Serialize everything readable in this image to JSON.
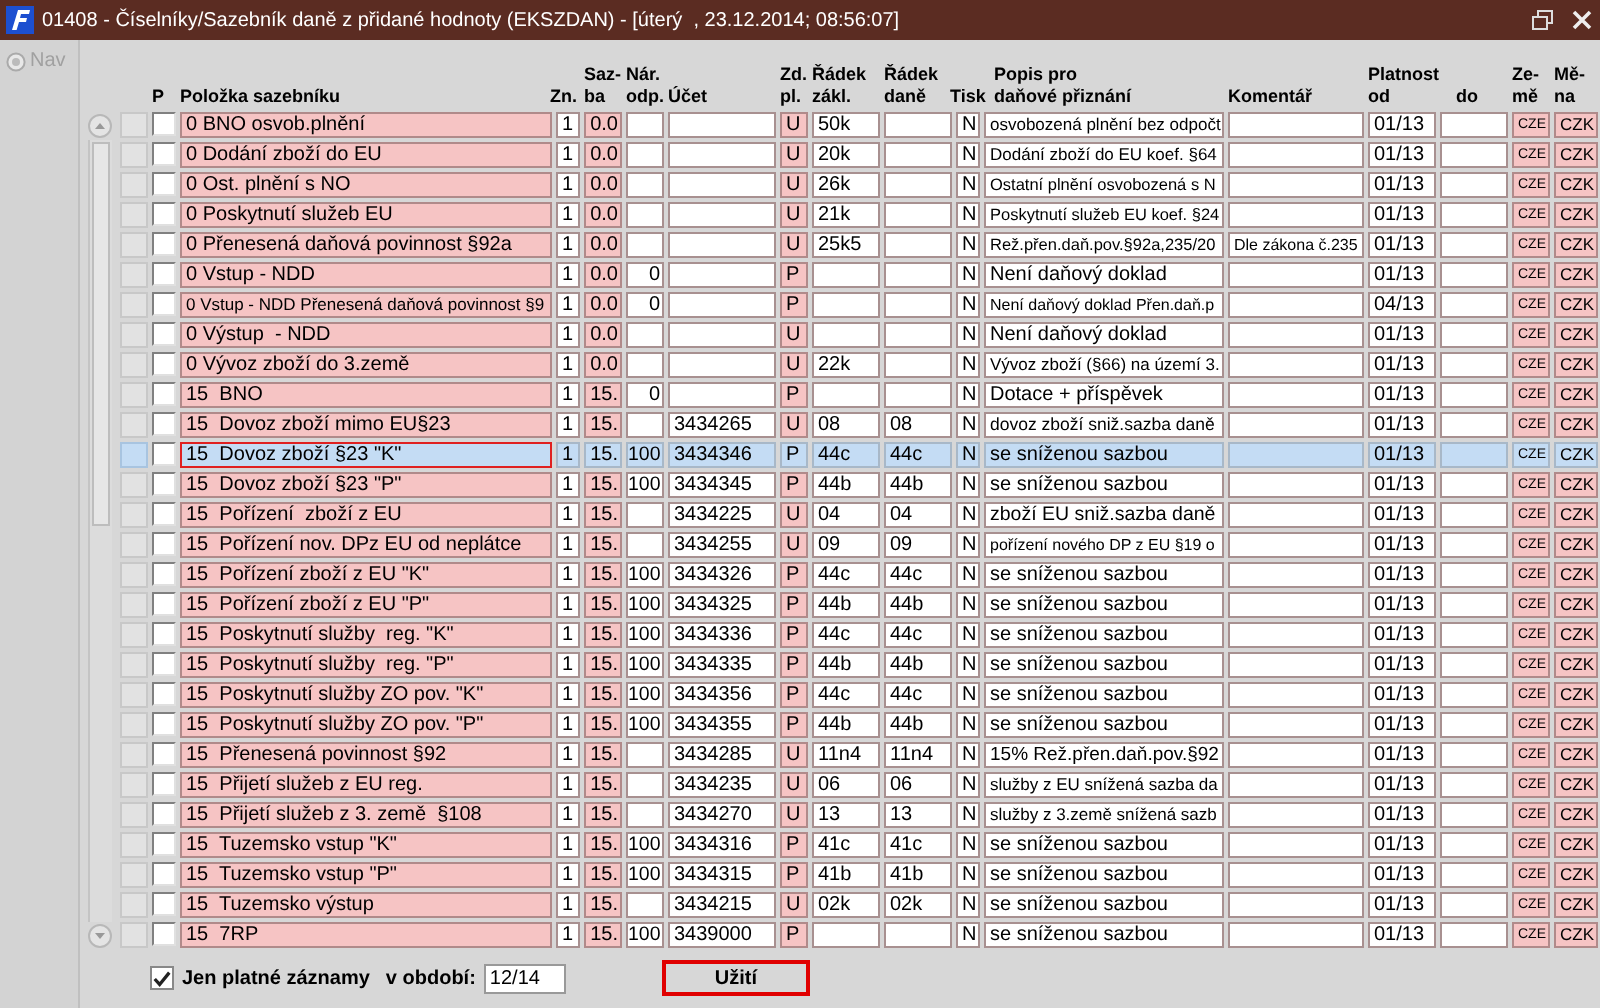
{
  "window": {
    "title": "01408 - Číselníky/Sazebník daně z přidané hodnoty (EKSZDAN) - [úterý  , 23.12.2014; 08:56:07]"
  },
  "nav": {
    "label": "Nav",
    "disabled": true
  },
  "table": {
    "columns": [
      {
        "label": "P"
      },
      {
        "label": "Položka sazebníku"
      },
      {
        "label": "Zn."
      },
      {
        "label": "Saz-\nba"
      },
      {
        "label": "Nár.\nodp."
      },
      {
        "label": "Účet"
      },
      {
        "label": "Zd.\npl."
      },
      {
        "label": "Řádek\nzákl."
      },
      {
        "label": "Řádek\ndaně"
      },
      {
        "label": "Tisk"
      },
      {
        "label": "Popis pro\ndaňové přiznání"
      },
      {
        "label": "Komentář"
      },
      {
        "label": "Platnost\nod"
      },
      {
        "label": "do"
      },
      {
        "label": "Ze-\nmě"
      },
      {
        "label": "Mě-\nna"
      }
    ],
    "rows": [
      {
        "selected": false,
        "checked": false,
        "item": "0 BNO osvob.plnění",
        "zn": "1",
        "sazba": "0.0",
        "zd_pl": "U",
        "radek_zakl": "50k",
        "tisk": "N",
        "popis": "osvobozená plnění bez odpočt",
        "platnost_od": "01/13",
        "zeme": "CZE",
        "mena": "CZK"
      },
      {
        "selected": false,
        "checked": false,
        "item": "0 Dodání zboží do EU",
        "zn": "1",
        "sazba": "0.0",
        "zd_pl": "U",
        "radek_zakl": "20k",
        "tisk": "N",
        "popis": "Dodání zboží do EU koef. §64",
        "platnost_od": "01/13",
        "zeme": "CZE",
        "mena": "CZK"
      },
      {
        "selected": false,
        "checked": false,
        "item": "0 Ost. plnění s NO",
        "zn": "1",
        "sazba": "0.0",
        "zd_pl": "U",
        "radek_zakl": "26k",
        "tisk": "N",
        "popis": "Ostatní plnění osvobozená s N",
        "platnost_od": "01/13",
        "zeme": "CZE",
        "mena": "CZK"
      },
      {
        "selected": false,
        "checked": false,
        "item": "0 Poskytnutí služeb EU",
        "zn": "1",
        "sazba": "0.0",
        "zd_pl": "U",
        "radek_zakl": "21k",
        "tisk": "N",
        "popis": "Poskytnutí služeb EU koef. §24",
        "platnost_od": "01/13",
        "zeme": "CZE",
        "mena": "CZK"
      },
      {
        "selected": false,
        "checked": false,
        "item": "0 Přenesená daňová povinnost §92a",
        "zn": "1",
        "sazba": "0.0",
        "zd_pl": "U",
        "radek_zakl": "25k5",
        "tisk": "N",
        "popis": "Rež.přen.daň.pov.§92a,235/20",
        "komentar": "Dle zákona č.235",
        "platnost_od": "01/13",
        "zeme": "CZE",
        "mena": "CZK"
      },
      {
        "selected": false,
        "checked": false,
        "item": "0 Vstup - NDD",
        "zn": "1",
        "sazba": "0.0",
        "nar_odp": "0",
        "zd_pl": "P",
        "tisk": "N",
        "popis": "Není daňový doklad",
        "platnost_od": "01/13",
        "zeme": "CZE",
        "mena": "CZK"
      },
      {
        "selected": false,
        "checked": false,
        "item": "0 Vstup - NDD Přenesená daňová povinnost §9",
        "zn": "1",
        "sazba": "0.0",
        "nar_odp": "0",
        "zd_pl": "P",
        "tisk": "N",
        "popis": "Není daňový doklad Přen.daň.p",
        "platnost_od": "04/13",
        "zeme": "CZE",
        "mena": "CZK"
      },
      {
        "selected": false,
        "checked": false,
        "item": "0 Výstup  - NDD",
        "zn": "1",
        "sazba": "0.0",
        "zd_pl": "U",
        "tisk": "N",
        "popis": "Není daňový doklad",
        "platnost_od": "01/13",
        "zeme": "CZE",
        "mena": "CZK"
      },
      {
        "selected": false,
        "checked": false,
        "item": "0 Vývoz zboží do 3.země",
        "zn": "1",
        "sazba": "0.0",
        "zd_pl": "U",
        "radek_zakl": "22k",
        "tisk": "N",
        "popis": "Vývoz zboží (§66) na území 3.",
        "platnost_od": "01/13",
        "zeme": "CZE",
        "mena": "CZK"
      },
      {
        "selected": false,
        "checked": false,
        "item": "15  BNO",
        "zn": "1",
        "sazba": "15.",
        "nar_odp": "0",
        "zd_pl": "P",
        "tisk": "N",
        "popis": "Dotace + příspěvek",
        "platnost_od": "01/13",
        "zeme": "CZE",
        "mena": "CZK"
      },
      {
        "selected": false,
        "checked": false,
        "item": "15  Dovoz zboží mimo EU§23",
        "zn": "1",
        "sazba": "15.",
        "ucet": "3434265",
        "zd_pl": "U",
        "radek_zakl": "08",
        "radek_dane": "08",
        "tisk": "N",
        "popis": "dovoz zboží sniž.sazba daně",
        "platnost_od": "01/13",
        "zeme": "CZE",
        "mena": "CZK"
      },
      {
        "selected": true,
        "checked": false,
        "item": "15  Dovoz zboží §23 \"K\"",
        "zn": "1",
        "sazba": "15.",
        "nar_odp": "100",
        "ucet": "3434346",
        "zd_pl": "P",
        "radek_zakl": "44c",
        "radek_dane": "44c",
        "tisk": "N",
        "popis": "se sníženou sazbou",
        "platnost_od": "01/13",
        "zeme": "CZE",
        "mena": "CZK"
      },
      {
        "selected": false,
        "checked": false,
        "item": "15  Dovoz zboží §23 \"P\"",
        "zn": "1",
        "sazba": "15.",
        "nar_odp": "100",
        "ucet": "3434345",
        "zd_pl": "P",
        "radek_zakl": "44b",
        "radek_dane": "44b",
        "tisk": "N",
        "popis": "se sníženou sazbou",
        "platnost_od": "01/13",
        "zeme": "CZE",
        "mena": "CZK"
      },
      {
        "selected": false,
        "checked": false,
        "item": "15  Pořízení  zboží z EU",
        "zn": "1",
        "sazba": "15.",
        "ucet": "3434225",
        "zd_pl": "U",
        "radek_zakl": "04",
        "radek_dane": "04",
        "tisk": "N",
        "popis": "zboží EU sniž.sazba daně",
        "platnost_od": "01/13",
        "zeme": "CZE",
        "mena": "CZK"
      },
      {
        "selected": false,
        "checked": false,
        "item": "15  Pořízení nov. DPz EU od neplátce",
        "zn": "1",
        "sazba": "15.",
        "ucet": "3434255",
        "zd_pl": "U",
        "radek_zakl": "09",
        "radek_dane": "09",
        "tisk": "N",
        "popis": "pořízení nového DP z EU §19 o",
        "platnost_od": "01/13",
        "zeme": "CZE",
        "mena": "CZK"
      },
      {
        "selected": false,
        "checked": false,
        "item": "15  Pořízení zboží z EU \"K\"",
        "zn": "1",
        "sazba": "15.",
        "nar_odp": "100",
        "ucet": "3434326",
        "zd_pl": "P",
        "radek_zakl": "44c",
        "radek_dane": "44c",
        "tisk": "N",
        "popis": "se sníženou sazbou",
        "platnost_od": "01/13",
        "zeme": "CZE",
        "mena": "CZK"
      },
      {
        "selected": false,
        "checked": false,
        "item": "15  Pořízení zboží z EU \"P\"",
        "zn": "1",
        "sazba": "15.",
        "nar_odp": "100",
        "ucet": "3434325",
        "zd_pl": "P",
        "radek_zakl": "44b",
        "radek_dane": "44b",
        "tisk": "N",
        "popis": "se sníženou sazbou",
        "platnost_od": "01/13",
        "zeme": "CZE",
        "mena": "CZK"
      },
      {
        "selected": false,
        "checked": false,
        "item": "15  Poskytnutí služby  reg. \"K\"",
        "zn": "1",
        "sazba": "15.",
        "nar_odp": "100",
        "ucet": "3434336",
        "zd_pl": "P",
        "radek_zakl": "44c",
        "radek_dane": "44c",
        "tisk": "N",
        "popis": "se sníženou sazbou",
        "platnost_od": "01/13",
        "zeme": "CZE",
        "mena": "CZK"
      },
      {
        "selected": false,
        "checked": false,
        "item": "15  Poskytnutí služby  reg. \"P\"",
        "zn": "1",
        "sazba": "15.",
        "nar_odp": "100",
        "ucet": "3434335",
        "zd_pl": "P",
        "radek_zakl": "44b",
        "radek_dane": "44b",
        "tisk": "N",
        "popis": "se sníženou sazbou",
        "platnost_od": "01/13",
        "zeme": "CZE",
        "mena": "CZK"
      },
      {
        "selected": false,
        "checked": false,
        "item": "15  Poskytnutí služby ZO pov. \"K\"",
        "zn": "1",
        "sazba": "15.",
        "nar_odp": "100",
        "ucet": "3434356",
        "zd_pl": "P",
        "radek_zakl": "44c",
        "radek_dane": "44c",
        "tisk": "N",
        "popis": "se sníženou sazbou",
        "platnost_od": "01/13",
        "zeme": "CZE",
        "mena": "CZK"
      },
      {
        "selected": false,
        "checked": false,
        "item": "15  Poskytnutí služby ZO pov. \"P\"",
        "zn": "1",
        "sazba": "15.",
        "nar_odp": "100",
        "ucet": "3434355",
        "zd_pl": "P",
        "radek_zakl": "44b",
        "radek_dane": "44b",
        "tisk": "N",
        "popis": "se sníženou sazbou",
        "platnost_od": "01/13",
        "zeme": "CZE",
        "mena": "CZK"
      },
      {
        "selected": false,
        "checked": false,
        "item": "15  Přenesená povinnost §92",
        "zn": "1",
        "sazba": "15.",
        "ucet": "3434285",
        "zd_pl": "U",
        "radek_zakl": "11n4",
        "radek_dane": "11n4",
        "tisk": "N",
        "popis": "15% Rež.přen.daň.pov.§92",
        "platnost_od": "01/13",
        "zeme": "CZE",
        "mena": "CZK"
      },
      {
        "selected": false,
        "checked": false,
        "item": "15  Přijetí služeb z EU reg.",
        "zn": "1",
        "sazba": "15.",
        "ucet": "3434235",
        "zd_pl": "U",
        "radek_zakl": "06",
        "radek_dane": "06",
        "tisk": "N",
        "popis": "služby z EU snížená sazba da",
        "platnost_od": "01/13",
        "zeme": "CZE",
        "mena": "CZK"
      },
      {
        "selected": false,
        "checked": false,
        "item": "15  Přijetí služeb z 3. země  §108",
        "zn": "1",
        "sazba": "15.",
        "ucet": "3434270",
        "zd_pl": "U",
        "radek_zakl": "13",
        "radek_dane": "13",
        "tisk": "N",
        "popis": "služby z 3.země snížená sazb",
        "platnost_od": "01/13",
        "zeme": "CZE",
        "mena": "CZK"
      },
      {
        "selected": false,
        "checked": false,
        "item": "15  Tuzemsko vstup \"K\"",
        "zn": "1",
        "sazba": "15.",
        "nar_odp": "100",
        "ucet": "3434316",
        "zd_pl": "P",
        "radek_zakl": "41c",
        "radek_dane": "41c",
        "tisk": "N",
        "popis": "se sníženou sazbou",
        "platnost_od": "01/13",
        "zeme": "CZE",
        "mena": "CZK"
      },
      {
        "selected": false,
        "checked": false,
        "item": "15  Tuzemsko vstup \"P\"",
        "zn": "1",
        "sazba": "15.",
        "nar_odp": "100",
        "ucet": "3434315",
        "zd_pl": "P",
        "radek_zakl": "41b",
        "radek_dane": "41b",
        "tisk": "N",
        "popis": "se sníženou sazbou",
        "platnost_od": "01/13",
        "zeme": "CZE",
        "mena": "CZK"
      },
      {
        "selected": false,
        "checked": false,
        "item": "15  Tuzemsko výstup",
        "zn": "1",
        "sazba": "15.",
        "ucet": "3434215",
        "zd_pl": "U",
        "radek_zakl": "02k",
        "radek_dane": "02k",
        "tisk": "N",
        "popis": "se sníženou sazbou",
        "platnost_od": "01/13",
        "zeme": "CZE",
        "mena": "CZK"
      },
      {
        "selected": false,
        "checked": false,
        "item": "15  7RP",
        "zn": "1",
        "sazba": "15.",
        "nar_odp": "100",
        "ucet": "3439000",
        "zd_pl": "P",
        "tisk": "N",
        "popis": "se sníženou sazbou",
        "platnost_od": "01/13",
        "zeme": "CZE",
        "mena": "CZK"
      }
    ]
  },
  "filter": {
    "checkbox_label": "Jen platné záznamy",
    "checked": true,
    "period_label": "v období:",
    "period_value": "12/14"
  },
  "buttons": [
    {
      "label": "Užití",
      "focused": true
    }
  ]
}
